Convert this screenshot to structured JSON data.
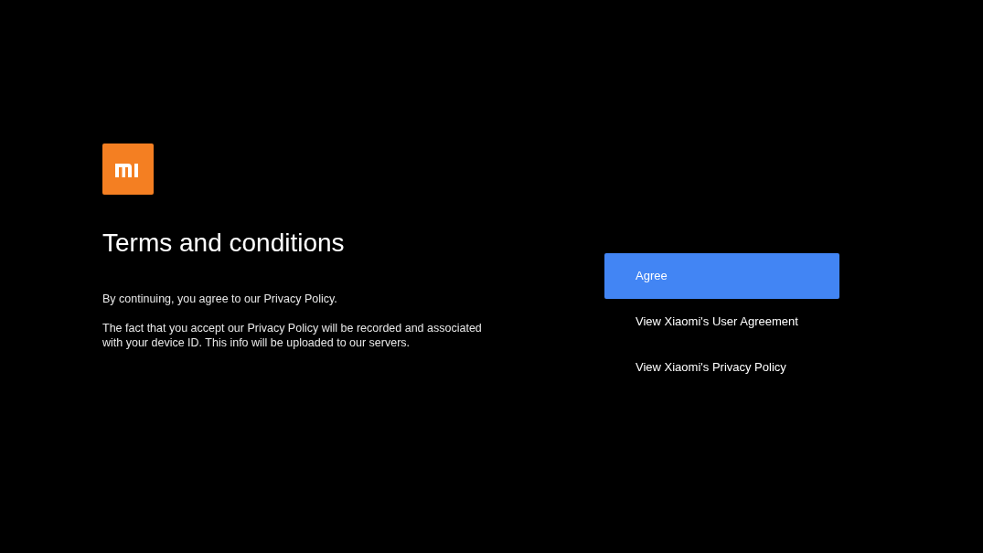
{
  "title": "Terms and conditions",
  "paragraphs": [
    "By continuing, you agree to our Privacy Policy.",
    "The fact that you accept our Privacy Policy will be recorded and associated with your device ID. This info will be uploaded to our servers."
  ],
  "options": [
    {
      "label": "Agree",
      "selected": true
    },
    {
      "label": "View Xiaomi's User Agreement",
      "selected": false
    },
    {
      "label": "View Xiaomi's Privacy Policy",
      "selected": false
    }
  ]
}
